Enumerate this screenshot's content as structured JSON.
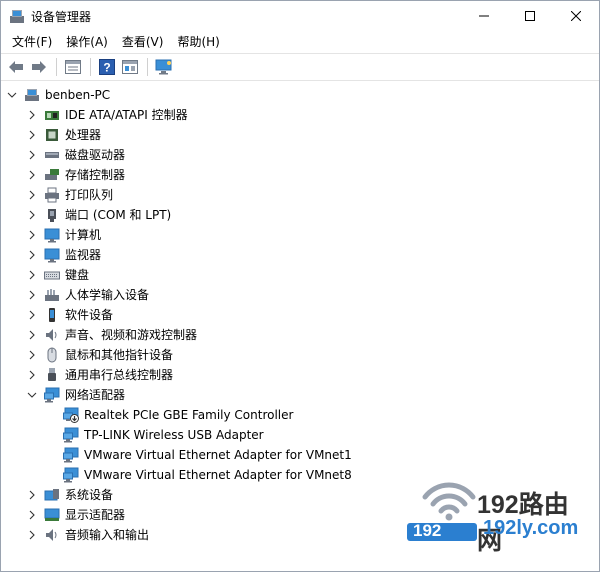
{
  "window": {
    "title": "设备管理器",
    "buttons": {
      "minimize": "—",
      "maximize": "☐",
      "close": "✕"
    }
  },
  "menu": [
    "文件(F)",
    "操作(A)",
    "查看(V)",
    "帮助(H)"
  ],
  "toolbar": [
    "back-arrow",
    "forward-arrow",
    "properties",
    "help",
    "show-hidden",
    "scan-hardware"
  ],
  "tree": {
    "root": {
      "label": "benben-PC",
      "expanded": true,
      "icon": "computer-icon"
    },
    "categories": [
      {
        "label": "IDE ATA/ATAPI 控制器",
        "icon": "ide-controller-icon",
        "expanded": false
      },
      {
        "label": "处理器",
        "icon": "processor-icon",
        "expanded": false
      },
      {
        "label": "磁盘驱动器",
        "icon": "disk-drive-icon",
        "expanded": false
      },
      {
        "label": "存储控制器",
        "icon": "storage-controller-icon",
        "expanded": false
      },
      {
        "label": "打印队列",
        "icon": "printer-icon",
        "expanded": false
      },
      {
        "label": "端口 (COM 和 LPT)",
        "icon": "port-icon",
        "expanded": false
      },
      {
        "label": "计算机",
        "icon": "computer-monitor-icon",
        "expanded": false
      },
      {
        "label": "监视器",
        "icon": "monitor-icon",
        "expanded": false
      },
      {
        "label": "键盘",
        "icon": "keyboard-icon",
        "expanded": false
      },
      {
        "label": "人体学输入设备",
        "icon": "hid-icon",
        "expanded": false
      },
      {
        "label": "软件设备",
        "icon": "software-device-icon",
        "expanded": false
      },
      {
        "label": "声音、视频和游戏控制器",
        "icon": "speaker-icon",
        "expanded": false
      },
      {
        "label": "鼠标和其他指针设备",
        "icon": "mouse-icon",
        "expanded": false
      },
      {
        "label": "通用串行总线控制器",
        "icon": "usb-icon",
        "expanded": false
      },
      {
        "label": "网络适配器",
        "icon": "network-adapter-icon",
        "expanded": true,
        "children": [
          {
            "label": "Realtek PCIe GBE Family Controller",
            "icon": "network-adapter-warning-icon"
          },
          {
            "label": "TP-LINK Wireless USB Adapter",
            "icon": "network-adapter-icon"
          },
          {
            "label": "VMware Virtual Ethernet Adapter for VMnet1",
            "icon": "network-adapter-icon"
          },
          {
            "label": "VMware Virtual Ethernet Adapter for VMnet8",
            "icon": "network-adapter-icon"
          }
        ]
      },
      {
        "label": "系统设备",
        "icon": "system-device-icon",
        "expanded": false
      },
      {
        "label": "显示适配器",
        "icon": "display-adapter-icon",
        "expanded": false
      },
      {
        "label": "音频输入和输出",
        "icon": "audio-io-icon",
        "expanded": false
      }
    ]
  },
  "watermark": {
    "brand": "192路由网",
    "url_left": "192",
    "url_right": "192ly.com"
  },
  "colors": {
    "accent": "#2b7fd0",
    "tree_icon_blue": "#3a8fd6"
  }
}
